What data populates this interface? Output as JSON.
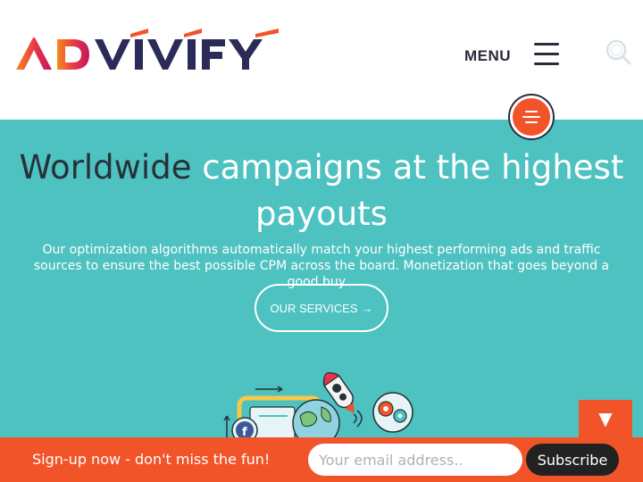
{
  "header": {
    "logo_text": "ADVIVIFY",
    "menu_label": "MENU"
  },
  "icons": {
    "hamburger": "hamburger-icon",
    "search": "search-icon",
    "fab": "menu-lines-icon",
    "arrow": "arrow-right-icon",
    "scroll": "triangle-down-icon"
  },
  "hero": {
    "headline_part1": "Worldwide",
    "headline_part2": "campaigns at the highest payouts",
    "subtext": "Our optimization algorithms automatically match your highest performing ads and traffic sources to ensure the best possible CPM across the board. Monetization that goes beyond a good buy...",
    "services_button": "OUR SERVICES",
    "services_arrow": "→"
  },
  "scroll_down": "▼",
  "signup": {
    "text": "Sign-up now - don't miss the fun!",
    "email_placeholder": "Your email address..",
    "subscribe_label": "Subscribe"
  },
  "colors": {
    "accent": "#f2542a",
    "hero_bg": "#4ec1c1",
    "dark_text": "#263238",
    "logo_gradient_start": "#f2542a",
    "logo_gradient_end": "#c2185b",
    "logo_dark": "#2b2b5a"
  }
}
